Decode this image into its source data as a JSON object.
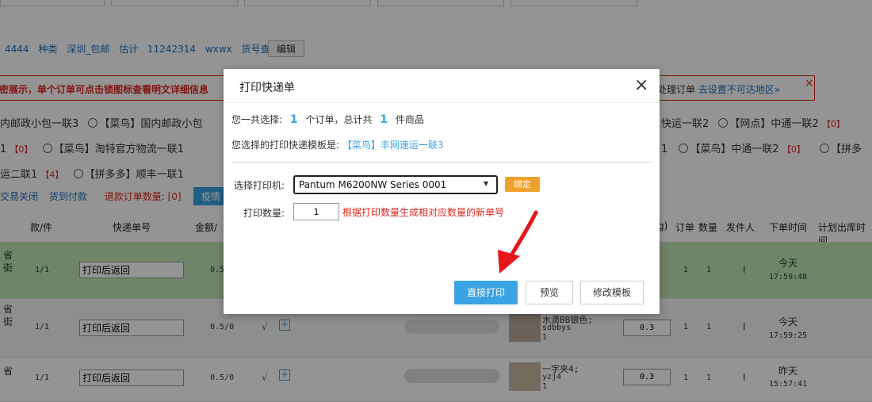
{
  "filter_bar": {
    "tags": [
      "4444",
      "种类",
      "深圳_包邮",
      "估计",
      "11242314",
      "wxwx",
      "货号查询"
    ],
    "edit_button": "编辑"
  },
  "notice": {
    "left_text": "密展示，单个订单可点击锁图标查看明文详细信息",
    "right_prefix": "处理订单",
    "right_link": "去设置不可达地区»",
    "close": "×"
  },
  "templates": {
    "row1": [
      "内邮政小包一联3",
      "【菜鸟】国内邮政小包",
      "快运一联2",
      "【网点】中通一联2"
    ],
    "row1_badge": "【0】",
    "row2": [
      "1",
      "【菜鸟】淘特官方物流一联1",
      "1",
      "【菜鸟】中通一联2",
      "【拼多"
    ],
    "row2_badges": [
      "【0】",
      "【0】"
    ],
    "row3": [
      "运二联1",
      "【拼多多】顺丰一联1"
    ],
    "row3_badge": "【4】"
  },
  "status_bar": {
    "closed": "交易关闭",
    "cod": "货到付款",
    "refund_label": "退款订单数量:",
    "refund_count": "[0]",
    "epidemic": "疫情"
  },
  "table": {
    "headers": [
      "款/件",
      "快递单号",
      "金额/",
      "g)",
      "订单",
      "数量",
      "发件人",
      "下单时间",
      "计划出库时间"
    ],
    "rows": [
      {
        "region": "省",
        "region2": "街",
        "qty": "1/1",
        "tracking": "打印后返回",
        "amount": "0.5",
        "weight": "",
        "orders": "1",
        "count": "1",
        "sender": "I",
        "date": "今天",
        "time": "17:59:48",
        "highlight": true
      },
      {
        "region": "省",
        "region2": "街",
        "qty": "1/1",
        "tracking": "打印后返回",
        "amount": "0.5/0",
        "check": "√",
        "product": "水滴BB银色;",
        "sku": "sdbbys",
        "pnum": "1",
        "weight": "0.3",
        "orders": "1",
        "count": "1",
        "sender": "I",
        "date": "今天",
        "time": "17:59:25",
        "highlight": false
      },
      {
        "region": "省",
        "region2": "",
        "qty": "1/1",
        "tracking": "打印后返回",
        "amount": "0.5/0",
        "check": "√",
        "product": "一字夹4;",
        "sku": "yzj4",
        "pnum": "1",
        "weight": "0.3",
        "orders": "1",
        "count": "1",
        "sender": "I",
        "date": "昨天",
        "time": "15:57:41",
        "highlight": false
      }
    ]
  },
  "modal": {
    "title": "打印快递单",
    "close_icon": "×",
    "sel_prefix": "您一共选择:",
    "sel_orders": "1",
    "sel_mid": "个订单，总计共",
    "sel_items": "1",
    "sel_suffix": "件商品",
    "template_label": "您选择的打印快递模板是:",
    "template_name": "【菜鸟】丰网速运一联3",
    "printer_label": "选择打印机:",
    "printer_value": "Pantum M6200NW Series 0001",
    "bind_button": "绑定",
    "count_label": "打印数量:",
    "count_value": "1",
    "count_hint": "根据打印数量生成相对应数量的新单号",
    "print_button": "直接打印",
    "preview_button": "预览",
    "edit_template_button": "修改模板",
    "accent": "#3aa3e3",
    "bind_color": "#f0a02c"
  }
}
